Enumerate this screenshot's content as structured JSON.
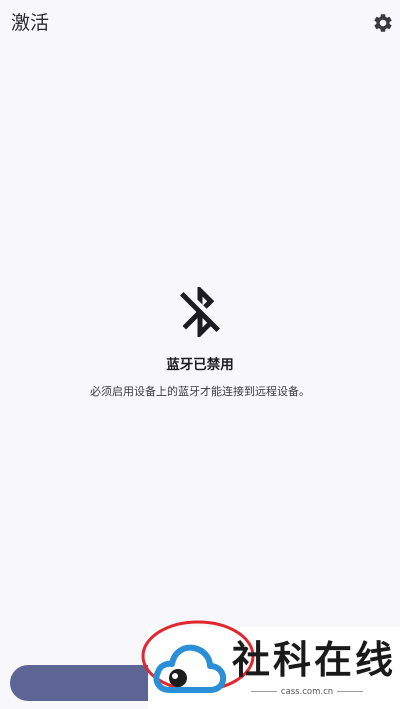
{
  "app_bar": {
    "title": "激活",
    "settings_icon": "gear-icon"
  },
  "empty_state": {
    "icon": "bluetooth-disabled-icon",
    "title": "蓝牙已禁用",
    "description": "必须启用设备上的蓝牙才能连接到远程设备。"
  },
  "bottom": {
    "button_color": "#5d6594"
  },
  "watermark": {
    "brand": "社科在线",
    "url": "cass.com.cn",
    "ring_color": "#e0282e",
    "cloud_color": "#2a8fd6"
  }
}
